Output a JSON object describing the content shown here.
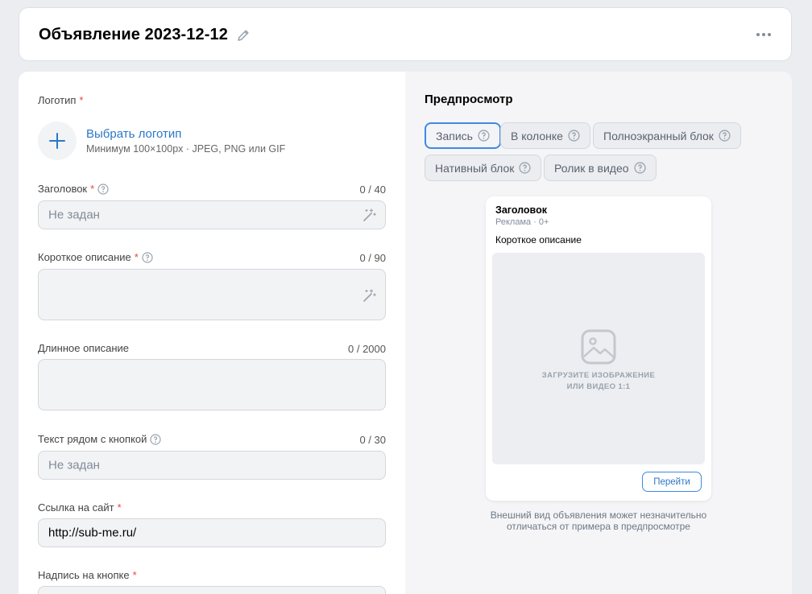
{
  "header": {
    "title": "Объявление 2023-12-12",
    "edit_icon": "pencil-icon",
    "more_icon": "more-horizontal-icon"
  },
  "form": {
    "logo": {
      "label": "Логотип",
      "required_mark": "*",
      "add_icon": "plus-icon",
      "link": "Выбрать логотип",
      "hint": "Минимум 100×100px · JPEG, PNG или GIF"
    },
    "headline": {
      "label": "Заголовок",
      "required_mark": "*",
      "counter": "0 / 40",
      "placeholder": "Не задан",
      "value": ""
    },
    "short_description": {
      "label": "Короткое описание",
      "required_mark": "*",
      "counter": "0 / 90",
      "value": ""
    },
    "long_description": {
      "label": "Длинное описание",
      "counter": "0 / 2000",
      "value": ""
    },
    "button_text": {
      "label": "Текст рядом с кнопкой",
      "counter": "0 / 30",
      "placeholder": "Не задан",
      "value": ""
    },
    "site_link": {
      "label": "Ссылка на сайт",
      "required_mark": "*",
      "value": "http://sub-me.ru/"
    },
    "button_caption": {
      "label": "Надпись на кнопке",
      "required_mark": "*"
    }
  },
  "preview": {
    "title": "Предпросмотр",
    "tabs": [
      {
        "label": "Запись",
        "active": true
      },
      {
        "label": "В колонке",
        "active": false
      },
      {
        "label": "Полноэкранный блок",
        "active": false
      },
      {
        "label": "Нативный блок",
        "active": false
      },
      {
        "label": "Ролик в видео",
        "active": false
      }
    ],
    "ad": {
      "title": "Заголовок",
      "meta": "Реклама · 0+",
      "description": "Короткое описание",
      "media_icon": "image-icon",
      "media_text_line1": "ЗАГРУЗИТЕ ИЗОБРАЖЕНИЕ",
      "media_text_line2": "ИЛИ ВИДЕО 1:1",
      "button": "Перейти"
    },
    "note_line1": "Внешний вид объявления может незначительно",
    "note_line2": "отличаться от примера в предпросмотре"
  },
  "colors": {
    "accent": "#2a78c8",
    "required": "#e64646",
    "page_bg": "#ebedf0"
  }
}
